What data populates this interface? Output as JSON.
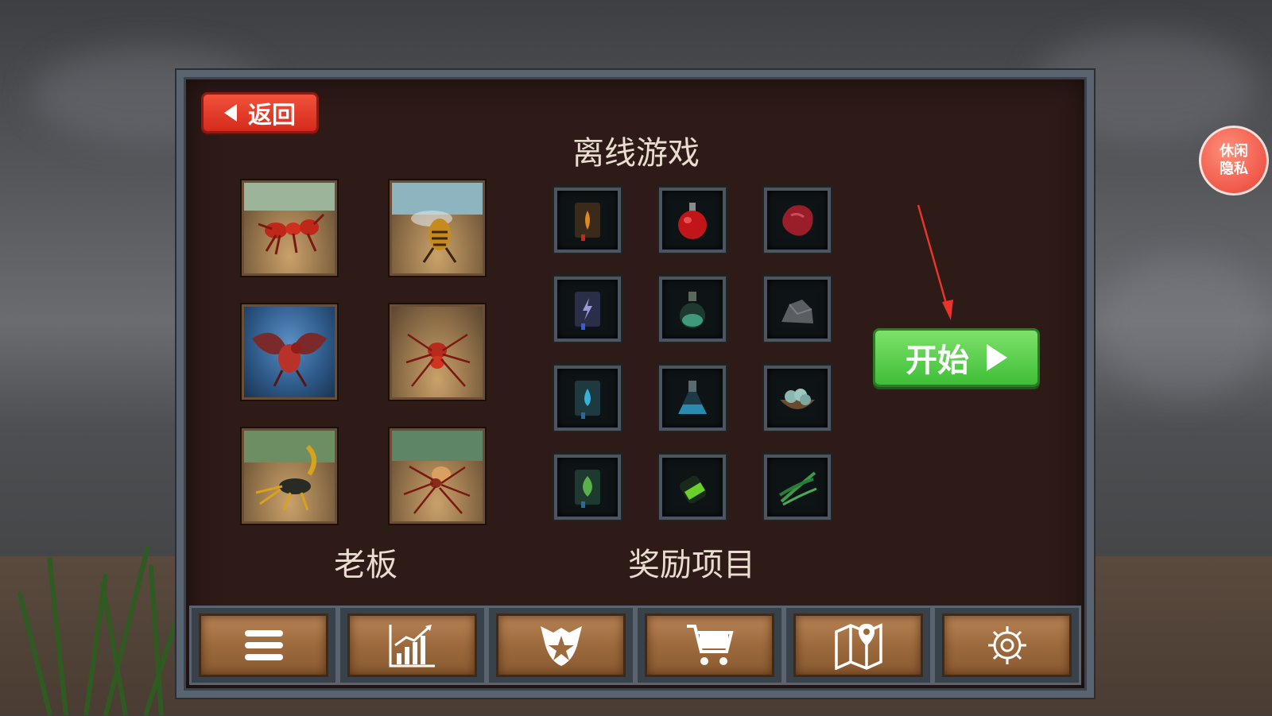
{
  "header": {
    "back_label": "返回",
    "title": "离线游戏"
  },
  "bosses": {
    "label": "老板",
    "items": [
      {
        "name": "red-ant-boss-icon"
      },
      {
        "name": "wasp-boss-icon"
      },
      {
        "name": "winged-insect-boss-icon"
      },
      {
        "name": "red-spider-boss-icon"
      },
      {
        "name": "scorpion-boss-icon"
      },
      {
        "name": "orange-spider-boss-icon"
      }
    ]
  },
  "rewards": {
    "label": "奖励项目",
    "items": [
      {
        "name": "fire-book-icon"
      },
      {
        "name": "red-potion-icon"
      },
      {
        "name": "meat-icon"
      },
      {
        "name": "lightning-book-icon"
      },
      {
        "name": "green-bottle-icon"
      },
      {
        "name": "stone-icon"
      },
      {
        "name": "water-book-icon"
      },
      {
        "name": "blue-flask-icon"
      },
      {
        "name": "bowl-of-eggs-icon"
      },
      {
        "name": "leaf-book-icon"
      },
      {
        "name": "green-vial-icon"
      },
      {
        "name": "grass-icon"
      }
    ]
  },
  "start": {
    "label": "开始"
  },
  "privacy": {
    "line1": "休闲",
    "line2": "隐私"
  },
  "toolbar": {
    "items": [
      {
        "name": "menu-icon"
      },
      {
        "name": "stats-chart-icon"
      },
      {
        "name": "clan-emblem-icon"
      },
      {
        "name": "shop-cart-icon"
      },
      {
        "name": "map-icon"
      },
      {
        "name": "settings-gear-icon"
      }
    ]
  },
  "colors": {
    "panel": "#2e1a17",
    "back": "#e23b28",
    "start": "#52c845",
    "frame": "#5a6470"
  }
}
